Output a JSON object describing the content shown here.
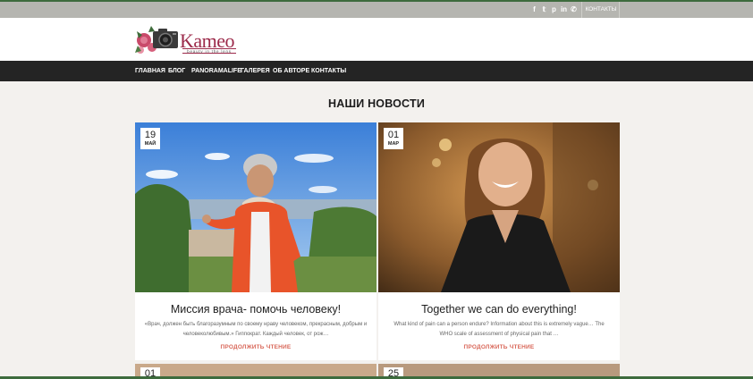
{
  "topbar": {
    "social_icons": [
      "facebook-icon",
      "twitter-icon",
      "pinterest-icon",
      "linkedin-icon",
      "whatsapp-icon"
    ],
    "social_glyphs": [
      "f",
      "𝕥",
      "p",
      "in",
      "✆"
    ],
    "contacts_label": "КОНТАКТЫ"
  },
  "logo": {
    "name": "Kameo",
    "tagline": "beauty in the lens"
  },
  "nav": {
    "items": [
      "ГЛАВНАЯ",
      "БЛОГ",
      "PANORAMALIFE",
      "ГАЛЕРЕЯ",
      "ОБ АВТОРЕ",
      "КОНТАКТЫ"
    ]
  },
  "main": {
    "section_title": "НАШИ НОВОСТИ",
    "posts": [
      {
        "day": "19",
        "month": "МАЙ",
        "title": "Миссия врача- помочь человеку!",
        "excerpt": "«Врач, должен быть благоразумным по своему нраву человеком, прекрасным, добрым и человеколюбивым.» Гиппократ. Каждый человек, от рож…",
        "read_more": "ПРОДОЛЖИТЬ ЧТЕНИЕ"
      },
      {
        "day": "01",
        "month": "МАР",
        "title": "Together we can do everything!",
        "excerpt": "What kind of pain can a person endure? Information about this is extremely vague… The WHO scale of assessment of physical pain that …",
        "read_more": "ПРОДОЛЖИТЬ ЧТЕНИЕ"
      }
    ],
    "partial_posts": [
      {
        "day": "01"
      },
      {
        "day": "25"
      }
    ]
  },
  "colors": {
    "accent": "#d9685a",
    "nav_bg": "#242424",
    "topbar_bg": "#b5b5b0",
    "logo_color": "#9c2a4a"
  }
}
